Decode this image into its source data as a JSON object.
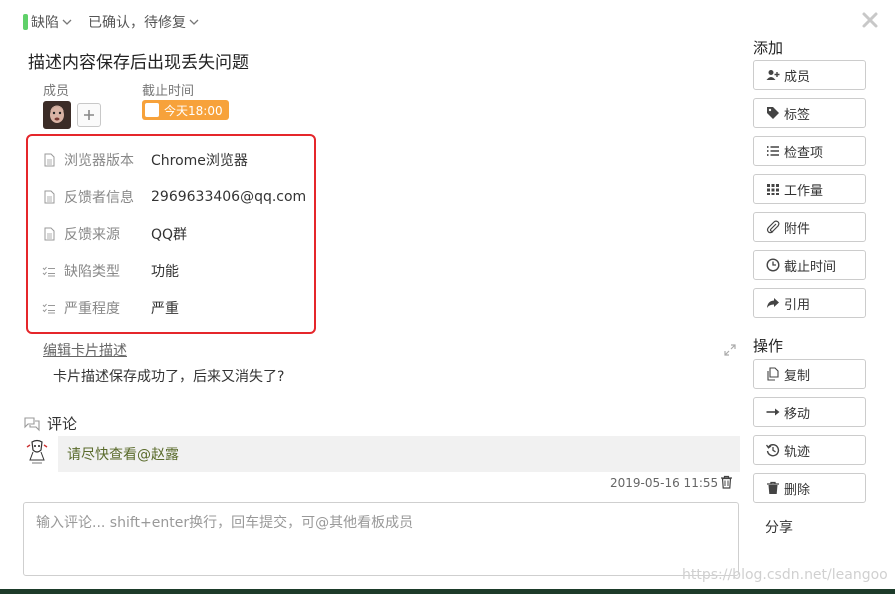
{
  "header": {
    "list_name": "缺陷",
    "status": "已确认，待修复",
    "label_color": "#5fd069"
  },
  "card": {
    "title": "描述内容保存后出现丢失问题",
    "members_label": "成员",
    "due_label": "截止时间",
    "due_value": "今天18:00",
    "due_color": "#f7a23b"
  },
  "fields": [
    {
      "icon": "document-icon",
      "name": "浏览器版本",
      "value": "Chrome浏览器"
    },
    {
      "icon": "document-icon",
      "name": "反馈者信息",
      "value": "2969633406@qq.com"
    },
    {
      "icon": "document-icon",
      "name": "反馈来源",
      "value": "QQ群"
    },
    {
      "icon": "checklist-icon",
      "name": "缺陷类型",
      "value": "功能"
    },
    {
      "icon": "checklist-icon",
      "name": "严重程度",
      "value": "严重"
    }
  ],
  "description": {
    "edit_label": "编辑卡片描述",
    "text": "卡片描述保存成功了，后来又消失了?"
  },
  "comments": {
    "heading": "评论",
    "items": [
      {
        "text": "请尽快查看@赵露",
        "time": "2019-05-16 11:55"
      }
    ],
    "input_placeholder": "输入评论... shift+enter换行，回车提交，可@其他看板成员"
  },
  "sidebar": {
    "add_heading": "添加",
    "add_buttons": [
      {
        "icon": "add-user-icon",
        "label": "成员"
      },
      {
        "icon": "tag-icon",
        "label": "标签"
      },
      {
        "icon": "list-icon",
        "label": "检查项"
      },
      {
        "icon": "grid-icon",
        "label": "工作量"
      },
      {
        "icon": "paperclip-icon",
        "label": "附件"
      },
      {
        "icon": "clock-icon",
        "label": "截止时间"
      },
      {
        "icon": "share-arrow-icon",
        "label": "引用"
      }
    ],
    "action_heading": "操作",
    "action_buttons": [
      {
        "icon": "copy-icon",
        "label": "复制"
      },
      {
        "icon": "arrow-right-icon",
        "label": "移动"
      },
      {
        "icon": "history-icon",
        "label": "轨迹"
      },
      {
        "icon": "trash-icon",
        "label": "删除"
      }
    ],
    "share_label": "分享"
  },
  "watermark": "https://blog.csdn.net/leangoo",
  "colors": {
    "highlight_frame": "#e5262b",
    "accent_green": "#5fd069"
  }
}
